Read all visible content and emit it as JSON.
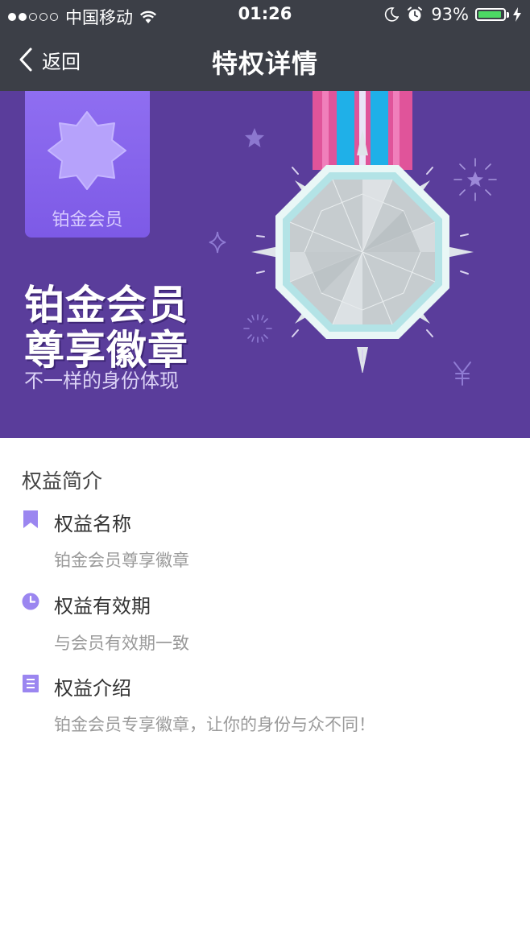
{
  "status_bar": {
    "signal_dots_filled": 2,
    "signal_dots_total": 5,
    "carrier": "中国移动",
    "time": "01:26",
    "battery_percent": "93%",
    "battery_level": 0.93,
    "icons": [
      "wifi-icon",
      "moon-icon",
      "alarm-icon",
      "battery-icon",
      "charging-bolt-icon"
    ]
  },
  "nav": {
    "back_label": "返回",
    "title": "特权详情"
  },
  "banner": {
    "tag_label": "铂金会员",
    "headline_line1": "铂金会员",
    "headline_line2": "尊享徽章",
    "subline": "不一样的身份体现",
    "colors": {
      "background": "#5a3d9b",
      "tag": "#8465ea",
      "ribbon_pink": "#e0549a",
      "ribbon_blue": "#1fb0e8"
    }
  },
  "content": {
    "section_title": "权益简介",
    "accent_color": "#9b86f0",
    "items": [
      {
        "icon": "bookmark-icon",
        "title": "权益名称",
        "desc": "铂金会员尊享徽章"
      },
      {
        "icon": "clock-icon",
        "title": "权益有效期",
        "desc": "与会员有效期一致"
      },
      {
        "icon": "document-icon",
        "title": "权益介绍",
        "desc": "铂金会员专享徽章，让你的身份与众不同！"
      }
    ]
  }
}
